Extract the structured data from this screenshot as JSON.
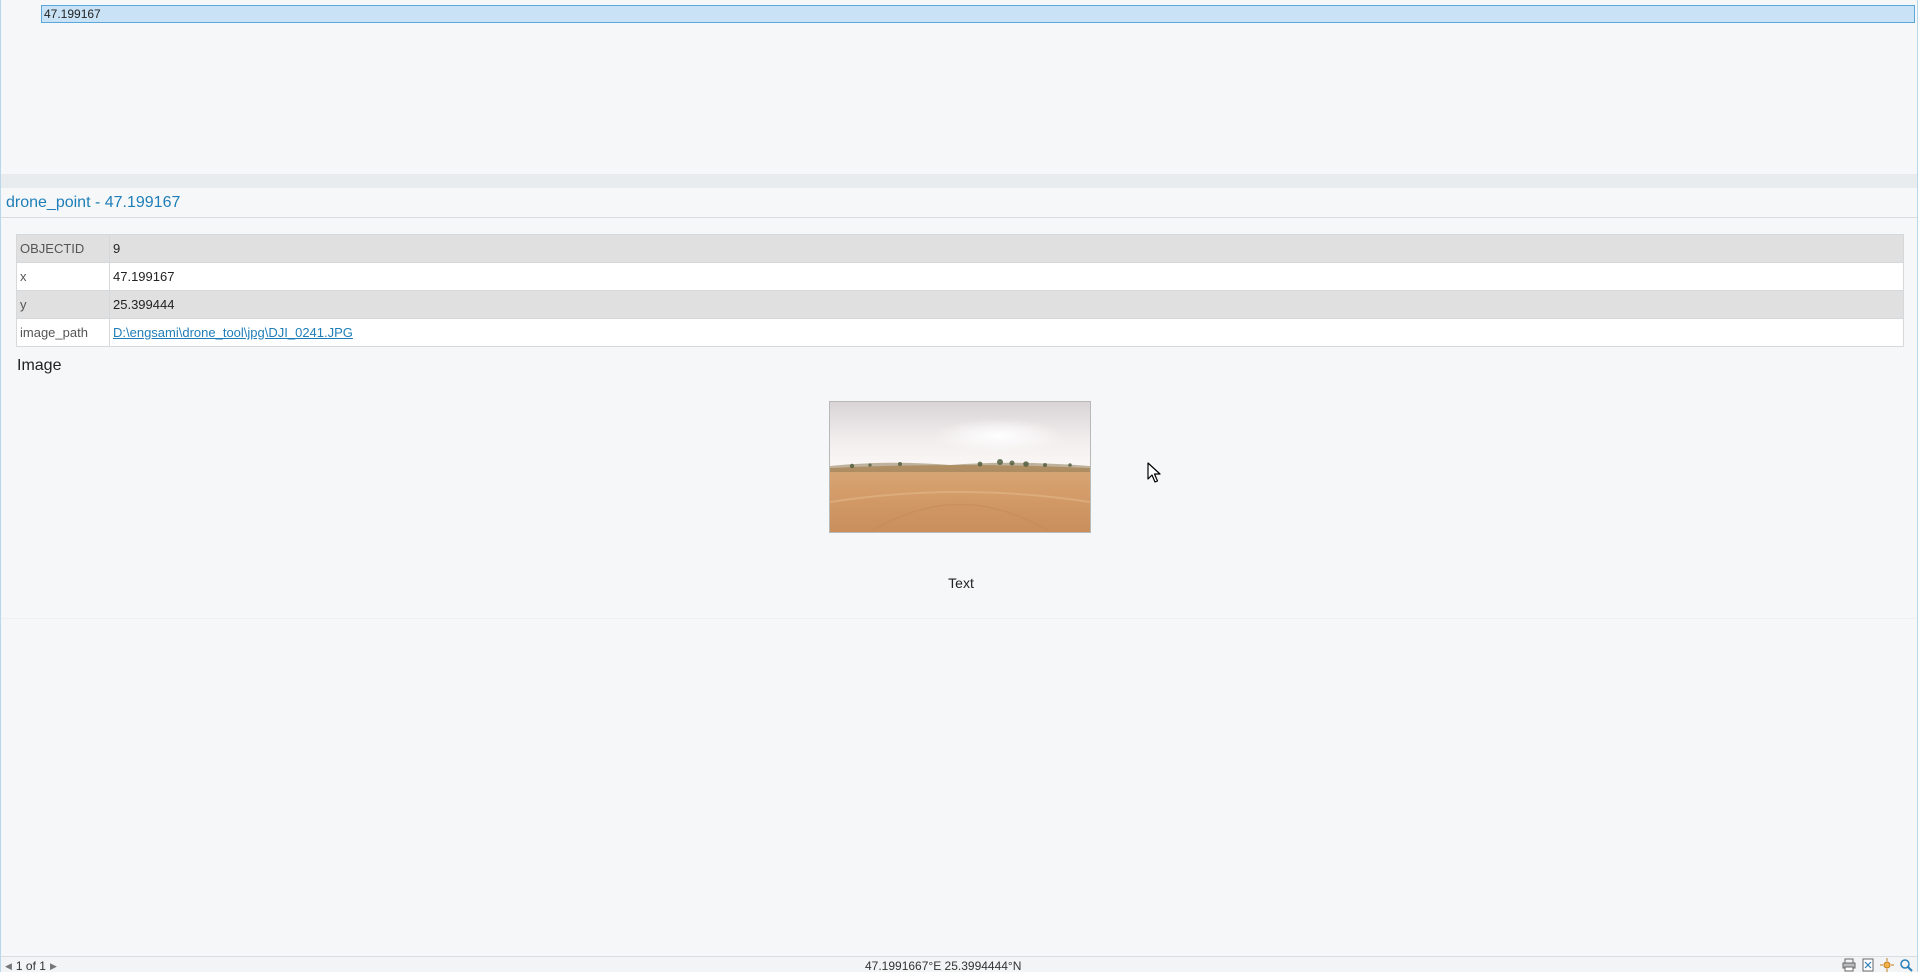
{
  "results": {
    "selected_value": "47.199167"
  },
  "popup": {
    "title": "drone_point - 47.199167",
    "fields": [
      {
        "name": "OBJECTID",
        "value": "9"
      },
      {
        "name": "x",
        "value": "47.199167"
      },
      {
        "name": "y",
        "value": "25.399444"
      },
      {
        "name": "image_path",
        "value": "D:\\engsami\\drone_tool\\jpg\\DJI_0241.JPG"
      }
    ],
    "image_section_label": "Image",
    "image_caption": "Text"
  },
  "statusbar": {
    "page_label": "1 of 1",
    "coordinates": "47.1991667°E 25.3994444°N"
  },
  "colors": {
    "accent": "#1f7eb8",
    "selection": "#c9e2f5",
    "selection_border": "#5aa7dc"
  },
  "icons": {
    "prev_page": "triangle-left-icon",
    "next_page": "triangle-right-icon",
    "status_tools": [
      "print-icon",
      "export-icon",
      "flash-icon",
      "zoom-icon"
    ]
  }
}
